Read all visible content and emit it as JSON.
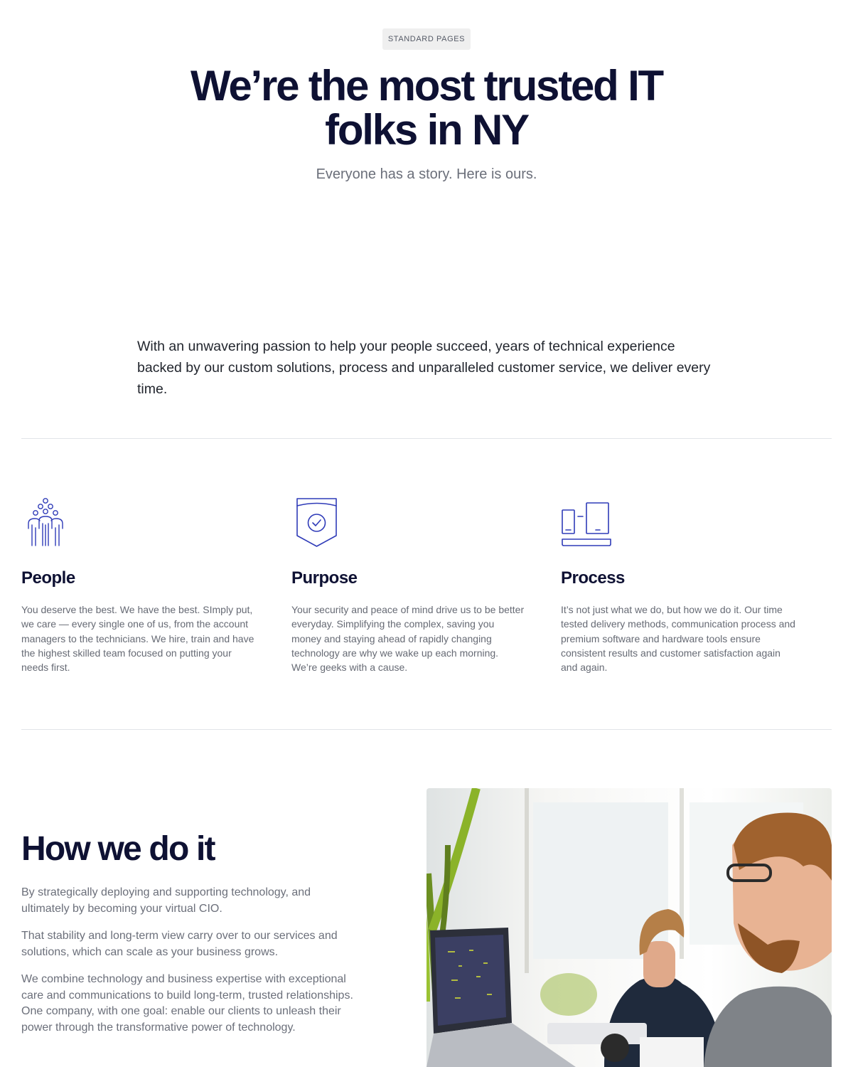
{
  "hero": {
    "eyebrow": "STANDARD PAGES",
    "title": "We’re the most trusted IT folks in NY",
    "subtitle": "Everyone has a story. Here is ours."
  },
  "intro": {
    "text": "With an unwavering passion to help your people succeed, years of technical experience backed by our custom solutions, process and unparalleled customer service, we deliver every time."
  },
  "features": [
    {
      "icon": "people-group-icon",
      "title": "People",
      "text": "You deserve the best. We have the best. SImply put, we care — every single one of us, from the account managers to the technicians. We hire, train and have the highest skilled team focused on putting your needs first."
    },
    {
      "icon": "shield-check-icon",
      "title": "Purpose",
      "text": "Your security and peace of mind drive us to be better everyday. Simplifying the complex, saving you money and staying ahead of rapidly changing technology are why we wake up each morning. We’re geeks with a cause."
    },
    {
      "icon": "devices-icon",
      "title": "Process",
      "text": "It’s not just what we do, but how we do it. Our time tested delivery methods, communication process and premium software and hardware tools ensure consistent results and customer satisfaction again and again."
    }
  ],
  "how": {
    "title": "How we do it",
    "p1": "By strategically deploying and supporting technology, and ultimately by becoming your virtual CIO.",
    "p2": "That stability and long-term view carry over to our services and solutions, which can scale as your business grows.",
    "p3": "We combine technology and business expertise with exceptional care and communications to build long-term, trusted relationships. One company, with one goal: enable our clients to unleash their power through the transformative power of technology."
  },
  "colors": {
    "heading": "#0e1133",
    "accent_icon": "#2f3bb8",
    "body_text": "#6b6f7a",
    "divider": "#e2e4e8"
  }
}
